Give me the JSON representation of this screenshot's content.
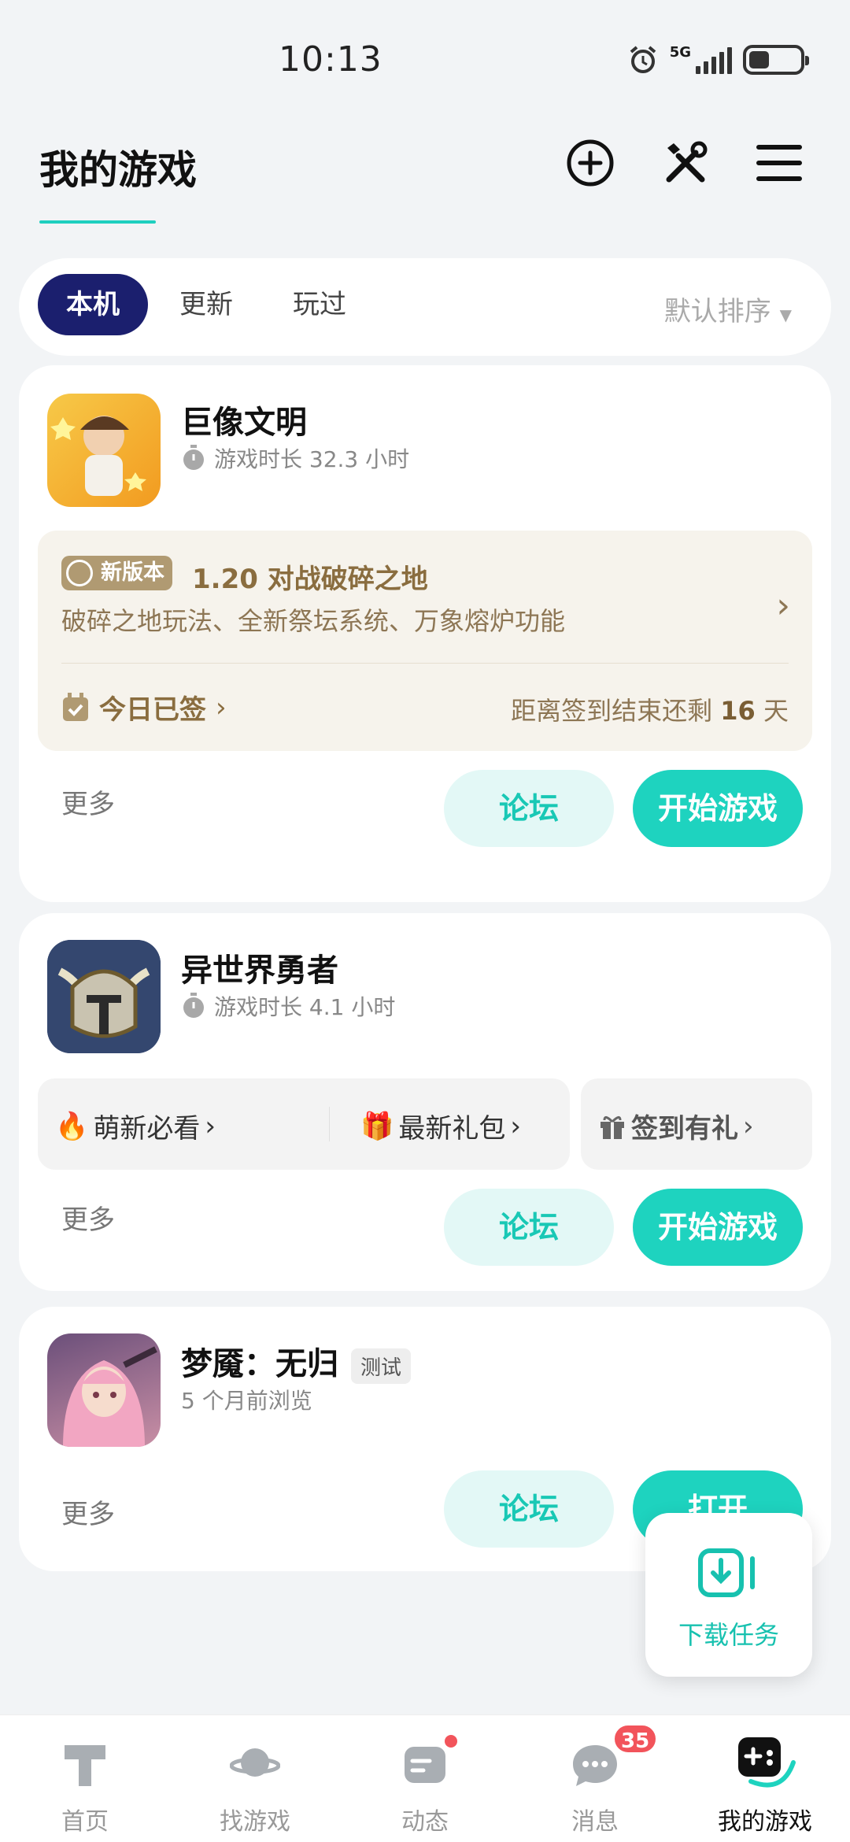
{
  "status_bar": {
    "time": "10:13",
    "network": "5G",
    "battery_level": 0.4
  },
  "header": {
    "title": "我的游戏",
    "icons": [
      "add-circle-icon",
      "tools-icon",
      "menu-icon"
    ]
  },
  "filter": {
    "tabs": [
      {
        "label": "本机",
        "active": true
      },
      {
        "label": "更新",
        "active": false
      },
      {
        "label": "玩过",
        "active": false
      }
    ],
    "sort_label": "默认排序"
  },
  "games": [
    {
      "name": "巨像文明",
      "playtime": "游戏时长 32.3 小时",
      "update": {
        "badge": "新版本",
        "title": "1.20 对战破碎之地",
        "description": "破碎之地玩法、全新祭坛系统、万象熔炉功能"
      },
      "checkin": {
        "label": "今日已签",
        "countdown_prefix": "距离签到结束还剩",
        "countdown_days": "16",
        "countdown_suffix": "天"
      },
      "more": "更多",
      "forum": "论坛",
      "action": "开始游戏"
    },
    {
      "name": "异世界勇者",
      "playtime": "游戏时长 4.1 小时",
      "links": [
        "萌新必看",
        "最新礼包",
        "签到有礼"
      ],
      "more": "更多",
      "forum": "论坛",
      "action": "开始游戏"
    },
    {
      "name": "梦魇：无归",
      "tag": "测试",
      "sub": "5 个月前浏览",
      "more": "更多",
      "forum": "论坛",
      "action": "打开"
    }
  ],
  "download_task": {
    "label": "下载任务"
  },
  "bottom_nav": {
    "items": [
      {
        "label": "首页",
        "icon": "home-icon"
      },
      {
        "label": "找游戏",
        "icon": "planet-icon"
      },
      {
        "label": "动态",
        "icon": "feed-icon"
      },
      {
        "label": "消息",
        "icon": "message-icon",
        "badge": "35"
      },
      {
        "label": "我的游戏",
        "icon": "gamepad-icon",
        "active": true
      }
    ]
  },
  "colors": {
    "accent": "#1ed3bf",
    "active_tab": "#1b1f6e",
    "badge": "#f2545b"
  }
}
